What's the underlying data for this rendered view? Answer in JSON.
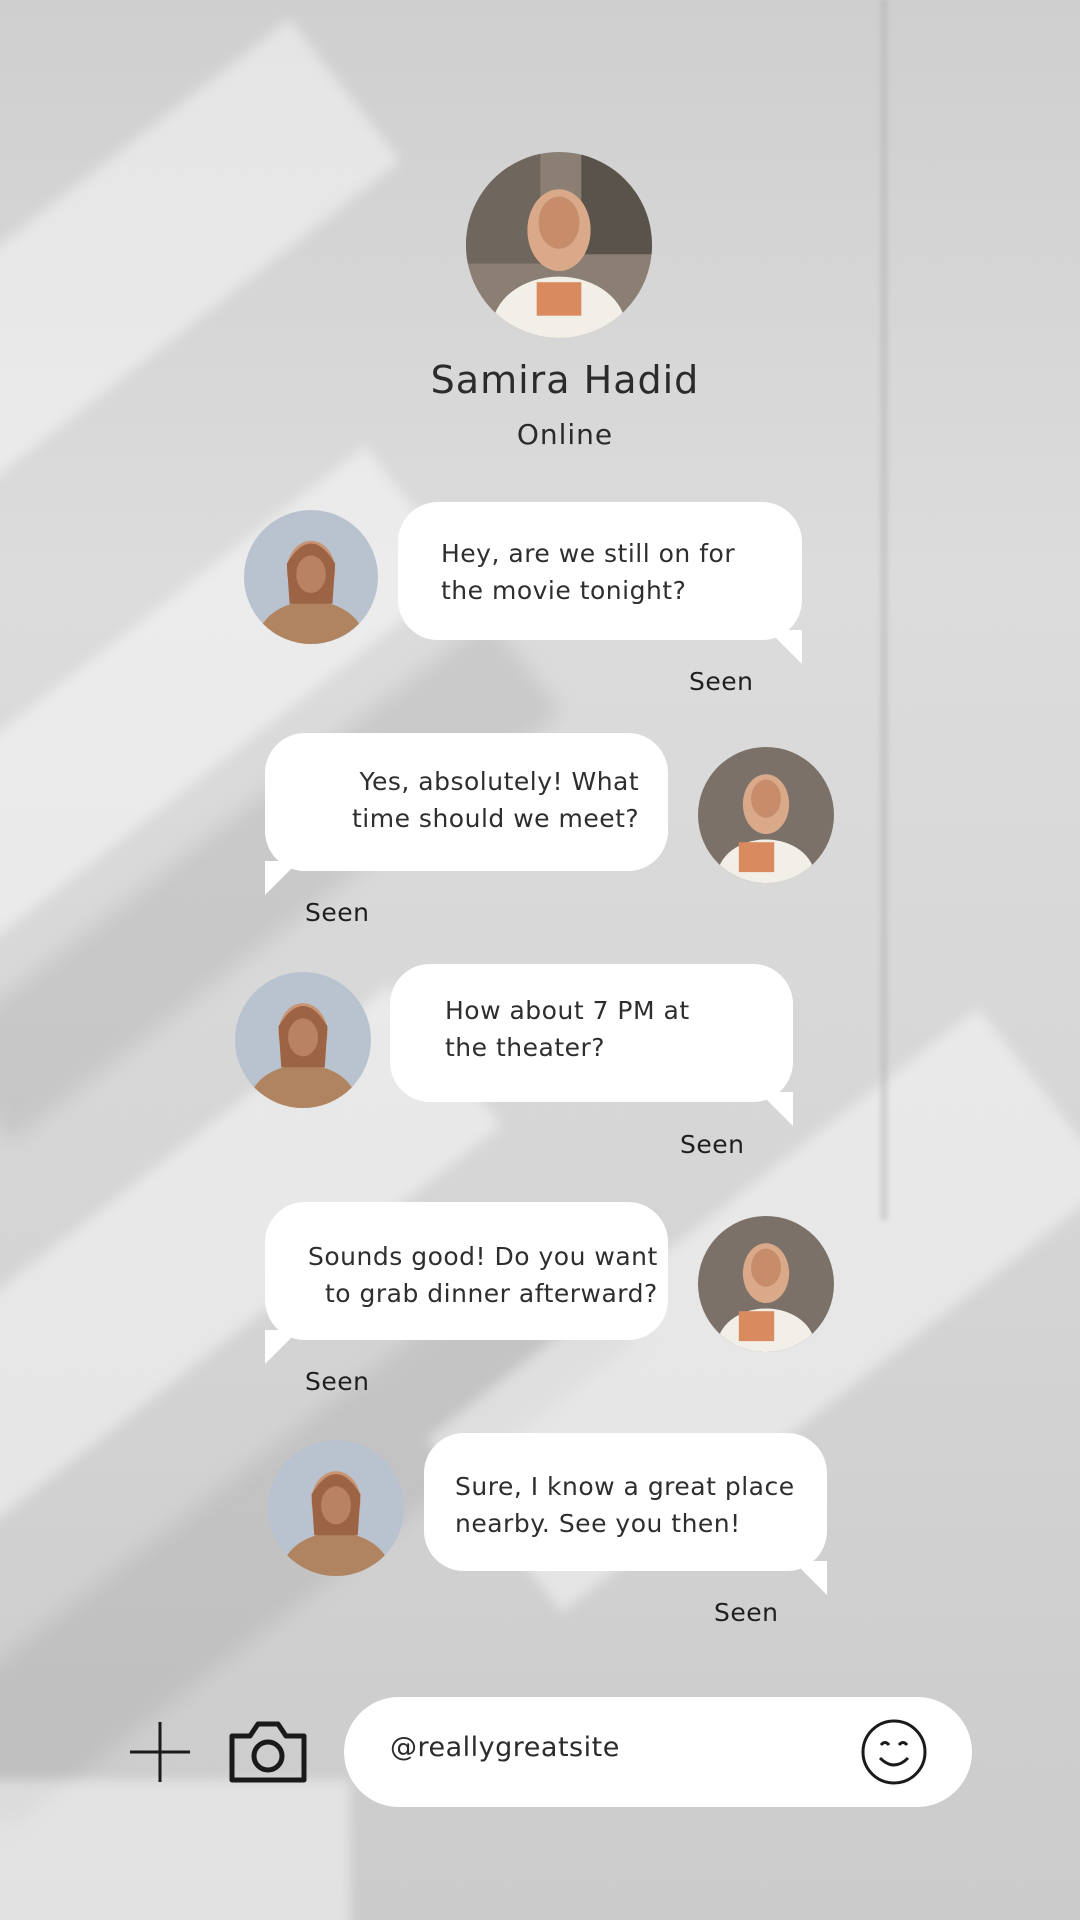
{
  "contact": {
    "name": "Samira Hadid",
    "status": "Online"
  },
  "messages": [
    {
      "lines": [
        "Hey, are we still on for",
        "the movie tonight?"
      ],
      "status": "Seen",
      "side": "incoming"
    },
    {
      "lines": [
        "Yes, absolutely! What",
        "time should we meet?"
      ],
      "status": "Seen",
      "side": "outgoing"
    },
    {
      "lines": [
        "How about 7 PM at",
        "the theater?"
      ],
      "status": "Seen",
      "side": "incoming"
    },
    {
      "lines": [
        "Sounds good! Do you want",
        "to grab dinner afterward?"
      ],
      "status": "Seen",
      "side": "outgoing"
    },
    {
      "lines": [
        "Sure, I know a great place",
        "nearby. See you then!"
      ],
      "status": "Seen",
      "side": "incoming"
    }
  ],
  "composer": {
    "text": "@reallygreatsite",
    "icons": [
      "plus-icon",
      "camera-icon",
      "smiley-icon"
    ]
  },
  "colors": {
    "bubble": "#ffffff",
    "text": "#2b2b2b",
    "background": "#d6d6d6"
  }
}
